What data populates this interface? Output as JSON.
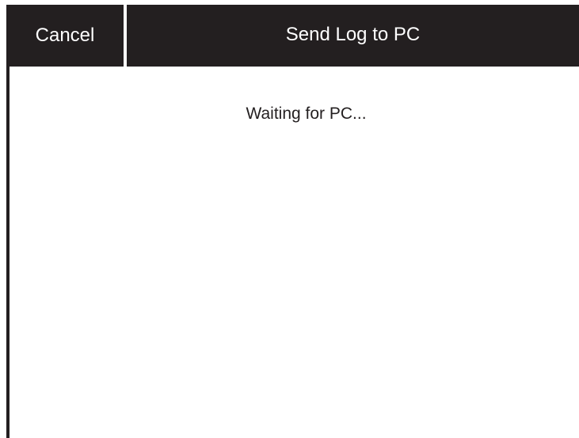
{
  "header": {
    "cancel_label": "Cancel",
    "title": "Send Log to PC"
  },
  "main": {
    "status": "Waiting for PC..."
  },
  "colors": {
    "bar": "#231f20",
    "text_on_bar": "#ffffff",
    "background": "#ffffff"
  }
}
